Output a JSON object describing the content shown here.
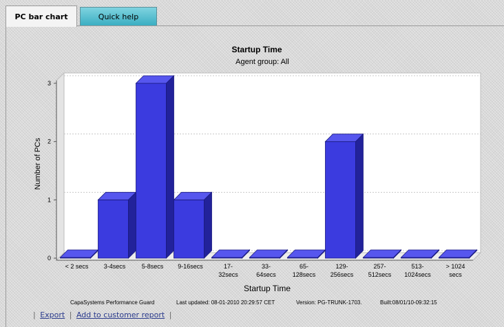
{
  "tabs": [
    {
      "label": "PC bar chart",
      "active": true
    },
    {
      "label": "Quick help",
      "active": false
    }
  ],
  "chart_data": {
    "type": "bar",
    "title": "Startup Time",
    "subtitle": "Agent group: All",
    "xlabel": "Startup Time",
    "ylabel": "Number of PCs",
    "categories": [
      [
        "< 2 secs"
      ],
      [
        "3-4secs"
      ],
      [
        "5-8secs"
      ],
      [
        "9-16secs"
      ],
      [
        "17-",
        "32secs"
      ],
      [
        "33-",
        "64secs"
      ],
      [
        "65-",
        "128secs"
      ],
      [
        "129-",
        "256secs"
      ],
      [
        "257-",
        "512secs"
      ],
      [
        "513-",
        "1024secs"
      ],
      [
        "> 1024",
        "secs"
      ]
    ],
    "values": [
      0,
      1,
      3,
      1,
      0,
      0,
      0,
      2,
      0,
      0,
      0
    ],
    "ylim": [
      0,
      3
    ],
    "yticks": [
      0,
      1,
      2,
      3
    ],
    "grid": true,
    "legend": "none",
    "colors": {
      "bar_front": "#3b3bdf",
      "bar_top": "#5656ee",
      "bar_side": "#22229a"
    }
  },
  "footer": {
    "product": "CapaSystems Performance Guard",
    "last_updated": "Last updated: 08-01-2010 20:29:57 CET",
    "version": "Version: PG-TRUNK-1703.",
    "built": "Built:08/01/10-09:32:15"
  },
  "links": {
    "export": "Export",
    "add_report": "Add to customer report",
    "separator": "|"
  }
}
